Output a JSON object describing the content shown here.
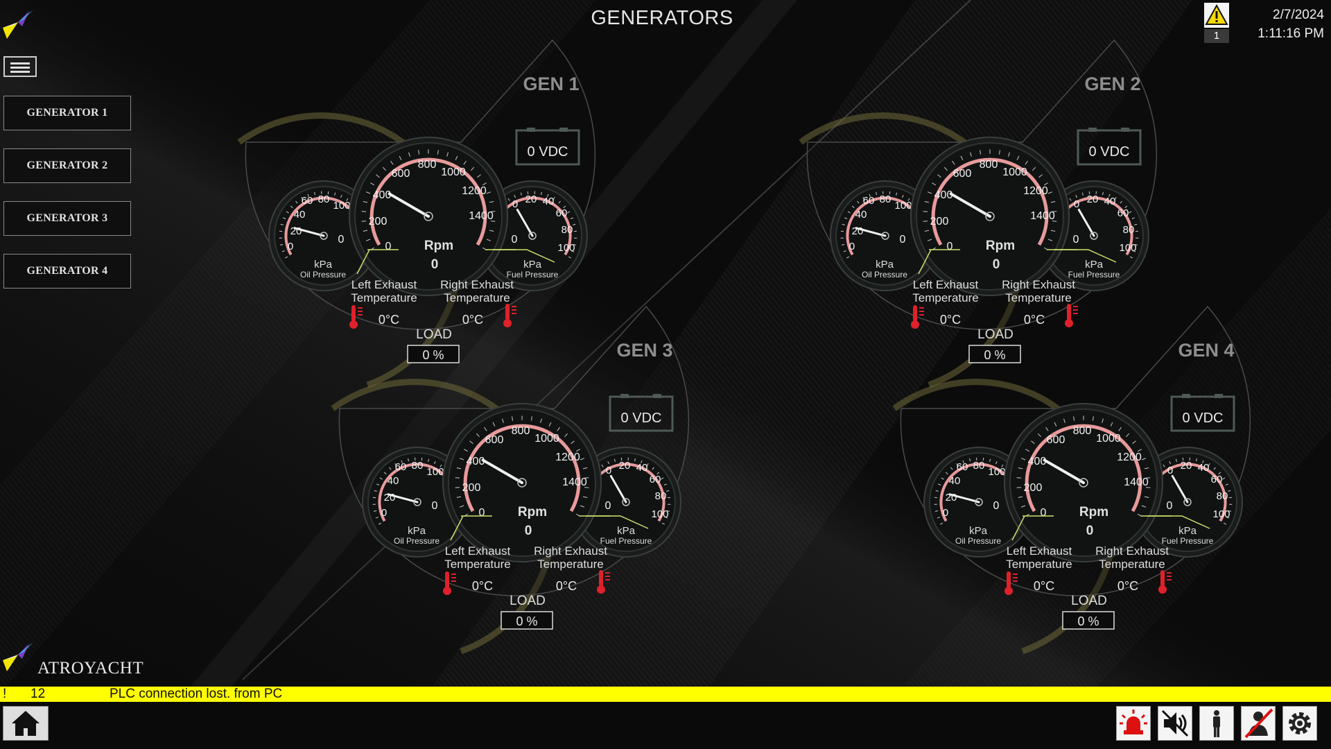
{
  "header": {
    "title": "GENERATORS",
    "date": "2/7/2024",
    "time": "1:11:16 PM",
    "alarm_count": "1"
  },
  "sidebar": {
    "items": [
      {
        "label": "GENERATOR 1"
      },
      {
        "label": "GENERATOR 2"
      },
      {
        "label": "GENERATOR 3"
      },
      {
        "label": "GENERATOR 4"
      }
    ]
  },
  "brand": {
    "name": "ATROYACHT"
  },
  "labels": {
    "oil_unit": "kPa",
    "oil_name": "Oil Pressure",
    "fuel_unit": "kPa",
    "fuel_name": "Fuel Pressure",
    "rpm_unit": "Rpm",
    "left_exhaust_1": "Left Exhaust",
    "right_exhaust_1": "Right Exhaust",
    "exhaust_2": "Temperature",
    "load": "LOAD",
    "rpm_ticks": [
      "0",
      "200",
      "400",
      "600",
      "800",
      "1000",
      "1200",
      "1400"
    ],
    "oil_ticks": [
      "0",
      "20",
      "40",
      "60",
      "80",
      "100"
    ],
    "fuel_ticks": [
      "0",
      "20",
      "40",
      "60",
      "80",
      "100"
    ]
  },
  "generators": [
    {
      "title": "GEN 1",
      "voltage": "0 VDC",
      "rpm": "0",
      "oil_pressure": "0",
      "fuel_pressure": "0",
      "left_temp": "0°C",
      "right_temp": "0°C",
      "load": "0 %"
    },
    {
      "title": "GEN 2",
      "voltage": "0 VDC",
      "rpm": "0",
      "oil_pressure": "0",
      "fuel_pressure": "0",
      "left_temp": "0°C",
      "right_temp": "0°C",
      "load": "0 %"
    },
    {
      "title": "GEN 3",
      "voltage": "0 VDC",
      "rpm": "0",
      "oil_pressure": "0",
      "fuel_pressure": "0",
      "left_temp": "0°C",
      "right_temp": "0°C",
      "load": "0 %"
    },
    {
      "title": "GEN 4",
      "voltage": "0 VDC",
      "rpm": "0",
      "oil_pressure": "0",
      "fuel_pressure": "0",
      "left_temp": "0°C",
      "right_temp": "0°C",
      "load": "0 %"
    }
  ],
  "alarm_banner": {
    "flag": "!",
    "id": "12",
    "message": "PLC connection lost. from PC"
  },
  "colors": {
    "alarm_bar": "#ffff00",
    "gauge_arc": "#e89a9a",
    "panel_glow": "#6f6a3a",
    "thermo": "#e0202a"
  },
  "bottom_toolbar": {
    "icons": [
      "home-icon",
      "siren-icon",
      "mute-icon",
      "person-icon",
      "person-disabled-icon",
      "settings-icon"
    ]
  }
}
